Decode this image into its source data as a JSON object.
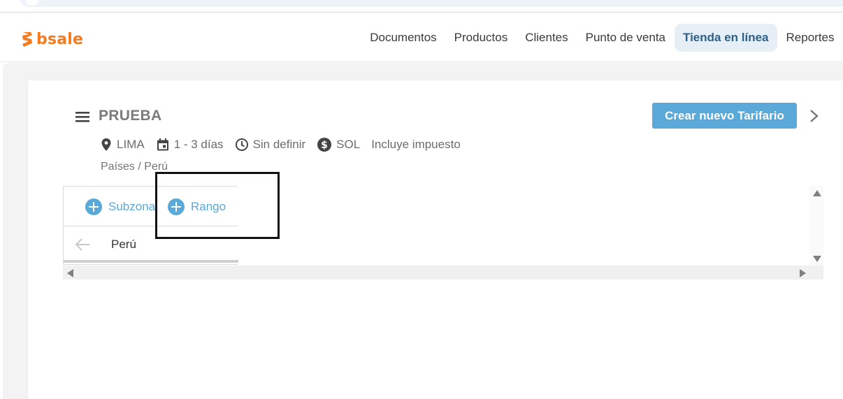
{
  "brand": {
    "name": "bsale",
    "color": "#f47b20"
  },
  "nav": {
    "items": [
      {
        "label": "Documentos",
        "active": false
      },
      {
        "label": "Productos",
        "active": false
      },
      {
        "label": "Clientes",
        "active": false
      },
      {
        "label": "Punto de venta",
        "active": false
      },
      {
        "label": "Tienda en línea",
        "active": true
      },
      {
        "label": "Reportes",
        "active": false
      }
    ]
  },
  "header": {
    "title": "PRUEBA",
    "create_button": "Crear nuevo Tarifario",
    "menu_icon": "hamburger-menu-icon",
    "next_icon": "chevron-right-icon"
  },
  "meta": {
    "location": "LIMA",
    "days": "1 - 3 días",
    "schedule": "Sin definir",
    "currency": "SOL",
    "tax": "Incluye impuesto"
  },
  "breadcrumb": "Países / Perú",
  "zones": {
    "actions": {
      "subzone": "Subzona",
      "range": "Rango"
    },
    "current": "Perú"
  },
  "colors": {
    "accent": "#5aa9d8",
    "active_nav_bg": "#e6eef6",
    "active_nav_text": "#2f5f86"
  }
}
